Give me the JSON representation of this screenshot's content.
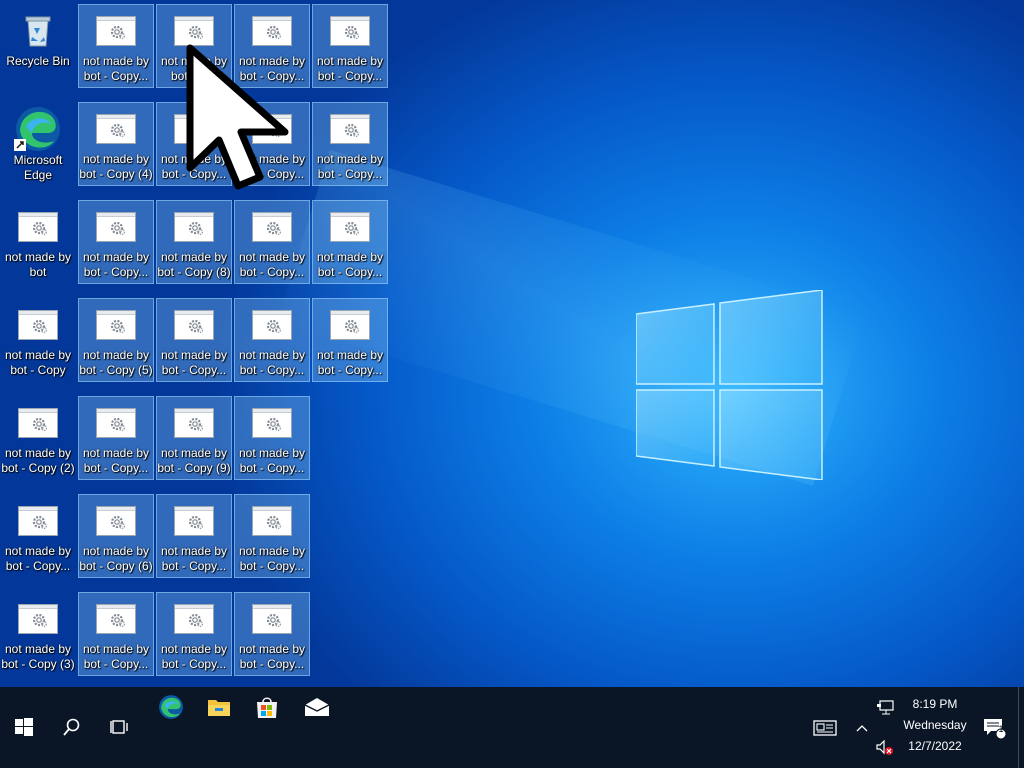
{
  "desktop": {
    "system_icons": [
      {
        "label": "Recycle Bin",
        "icon": "recycle-bin-icon"
      },
      {
        "label": "Microsoft Edge",
        "icon": "edge-icon"
      }
    ],
    "files": {
      "col1": [
        "not made by bot",
        "not made by bot - Copy",
        "not made by bot - Copy (2)",
        "not made by bot - Copy...",
        "not made by bot - Copy (3)"
      ],
      "col2": [
        "not made by bot - Copy...",
        "not made by bot - Copy (4)",
        "not made by bot - Copy...",
        "not made by bot - Copy (5)",
        "not made by bot - Copy...",
        "not made by bot - Copy (6)",
        "not made by bot - Copy..."
      ],
      "col3": [
        "not made by bot - C...",
        "not made by bot - Copy...",
        "not made by bot - Copy (8)",
        "not made by bot - Copy...",
        "not made by bot - Copy (9)",
        "not made by bot - Copy...",
        "not made by bot - Copy..."
      ],
      "col4": [
        "not made by bot - Copy...",
        "not made by bot - Copy...",
        "not made by bot - Copy...",
        "not made by bot - Copy...",
        "not made by bot - Copy...",
        "not made by bot - Copy...",
        "not made by bot - Copy..."
      ],
      "col5": [
        "not made by bot - Copy...",
        "not made by bot - Copy...",
        "not made by bot - Copy...",
        "not made by bot - Copy..."
      ]
    }
  },
  "taskbar": {
    "pinned": [
      "start-icon",
      "search-icon",
      "task-view-icon",
      "edge-icon",
      "file-explorer-icon",
      "store-icon",
      "mail-icon"
    ],
    "clock": {
      "time": "8:19 PM",
      "day": "Wednesday",
      "date": "12/7/2022"
    },
    "notification_count": "1",
    "colors": {
      "taskbar": "#0a1525",
      "accent": "#0078d7"
    }
  }
}
